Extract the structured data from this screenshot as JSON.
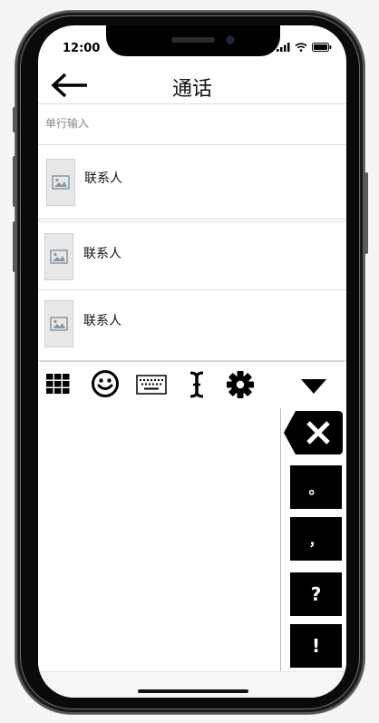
{
  "status": {
    "time": "12:00"
  },
  "header": {
    "title": "通话"
  },
  "input": {
    "placeholder": "单行输入",
    "value": ""
  },
  "contacts": [
    {
      "name": "联系人"
    },
    {
      "name": "联系人"
    },
    {
      "name": "联系人"
    }
  ],
  "toolbar": {
    "items": [
      "grid-icon",
      "smiley-icon",
      "keyboard-icon",
      "text-cursor-icon",
      "gear-icon",
      "triangle-down-icon"
    ]
  },
  "keys": {
    "delete": "✕",
    "period": "。",
    "comma": "，",
    "question": "?",
    "exclaim": "!"
  }
}
